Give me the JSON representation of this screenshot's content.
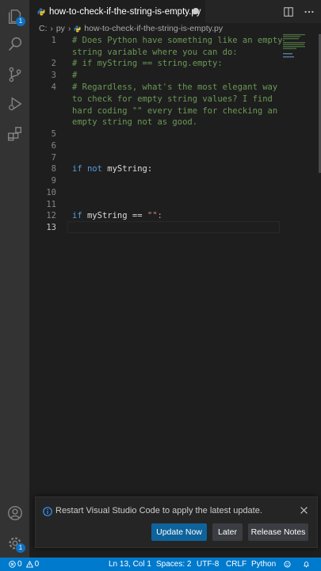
{
  "activity_bar": {
    "explorer_badge": "1",
    "manage_badge": "1"
  },
  "tab": {
    "label": "how-to-check-if-the-string-is-empty.py"
  },
  "breadcrumb": {
    "parts": [
      "C:",
      "py",
      "how-to-check-if-the-string-is-empty.py"
    ]
  },
  "editor": {
    "line_numbers": [
      "1",
      "2",
      "3",
      "4",
      "5",
      "6",
      "7",
      "8",
      "9",
      "10",
      "11",
      "12",
      "13"
    ],
    "active_line": "13",
    "code": {
      "l1a": "# Does Python have something like an empty",
      "l1b": "string variable where you can do:",
      "l2": "# if myString == string.empty:",
      "l3": "#",
      "l4a": "# Regardless, what's the most elegant way",
      "l4b": "to check for empty string values? I find",
      "l4c": "hard coding \"\" every time for checking an",
      "l4d": "empty string not as good.",
      "l8_if": "if",
      "l8_not": "not",
      "l8_var": "myString:",
      "l12_if": "if",
      "l12_var": "myString",
      "l12_op": "==",
      "l12_str": "\"\":",
      "l12_colon": ""
    }
  },
  "notification": {
    "message": "Restart Visual Studio Code to apply the latest update.",
    "update_now": "Update Now",
    "later": "Later",
    "release_notes": "Release Notes"
  },
  "status_bar": {
    "errors": "0",
    "warnings": "0",
    "position": "Ln 13, Col 1",
    "spaces": "Spaces: 2",
    "encoding": "UTF-8",
    "eol": "CRLF",
    "language": "Python"
  },
  "colors": {
    "accent": "#007acc",
    "comment": "#6a9955",
    "keyword": "#569cd6",
    "string": "#ce9178",
    "button_primary": "#0e639c"
  }
}
